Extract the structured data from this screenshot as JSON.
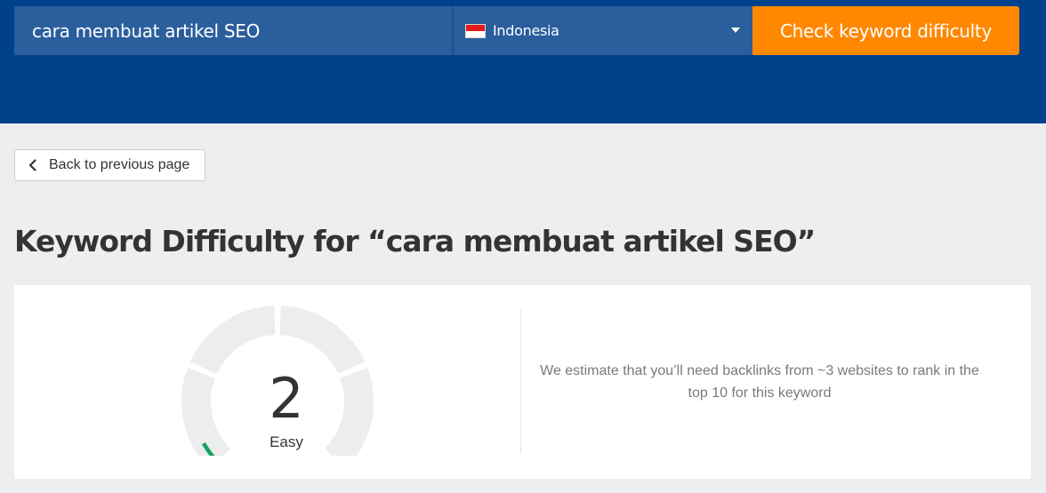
{
  "search": {
    "keyword": "cara membuat artikel SEO",
    "country": "Indonesia",
    "submit_label": "Check keyword difficulty"
  },
  "nav": {
    "back_label": "Back to previous page",
    "back_icon": "chevron-left-icon"
  },
  "result": {
    "title": "Keyword Difficulty for “cara membuat artikel SEO”",
    "score": "2",
    "score_value": 2,
    "score_max": 100,
    "level": "Easy",
    "estimate": "We estimate that you’ll need backlinks from ~3 websites to rank in the top 10 for this keyword"
  },
  "colors": {
    "header_bg": "#00418c",
    "input_bg": "#2a5e9d",
    "accent_orange": "#ff8800",
    "gauge_track": "#ecedee",
    "gauge_fill": "#19a15f",
    "page_bg": "#eceeef"
  }
}
